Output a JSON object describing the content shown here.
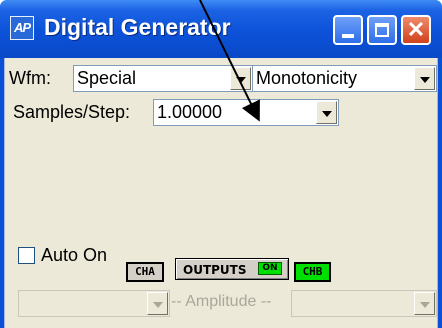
{
  "window": {
    "title": "Digital Generator",
    "icon_text": "AP",
    "minimize_icon": "minimize-icon",
    "maximize_icon": "maximize-icon",
    "close_icon": "close-icon",
    "close_glyph": "✕"
  },
  "wfm": {
    "label": "Wfm:",
    "type_value": "Special",
    "subtype_value": "Monotonicity"
  },
  "samples_step": {
    "label": "Samples/Step:",
    "value": "1.00000"
  },
  "auto_on": {
    "label": "Auto On",
    "checked": false
  },
  "channels": {
    "cha_label": "CHA",
    "outputs_label": "OUTPUTS",
    "outputs_state": "ON",
    "chb_label": "CHB"
  },
  "amplitude": {
    "label": "-- Amplitude --",
    "left_value": "",
    "right_value": ""
  },
  "colors": {
    "titlebar": "#0c52d9",
    "face": "#ece9d8",
    "on_indicator": "#00e000"
  }
}
